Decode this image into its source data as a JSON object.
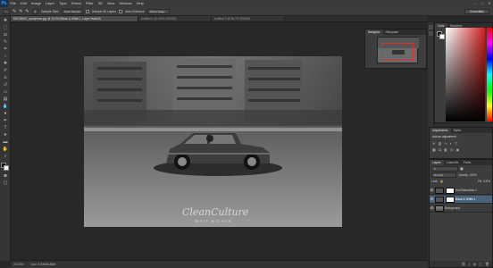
{
  "app": {
    "logo": "Ps",
    "window_controls": [
      "–",
      "□",
      "✕"
    ]
  },
  "menubar": [
    "File",
    "Edit",
    "Image",
    "Layer",
    "Type",
    "Select",
    "Filter",
    "3D",
    "View",
    "Window",
    "Help"
  ],
  "options_bar": {
    "sample_size_label": "Sample Size:",
    "sample_size_value": "Point Sample",
    "sample_all_layers": "Sample All Layers",
    "auto_enhance": "Auto-Enhance",
    "refine_edge": "Refine Edge...",
    "workspace": "Essentials"
  },
  "tabs": [
    {
      "label": "DSC06067_wordpress.jpg @ 33.3% (Black & White 1, Layer Mask/8)",
      "active": true
    },
    {
      "label": "Untitled-1 @ 100% (RGB/8)",
      "active": false
    },
    {
      "label": "Untitled-2 @ 66.7% (RGB/8)",
      "active": false
    }
  ],
  "status": {
    "zoom": "33.33%",
    "doc": "Doc: 5.93M/8.88M"
  },
  "photo": {
    "watermark_script": "CleanCulture",
    "watermark_name": "MATT WILSON"
  },
  "panels": {
    "navigator_tabs": [
      "Navigator",
      "Histogram"
    ],
    "swatch_tabs": [
      "Color",
      "Swatches"
    ],
    "adjust_tabs": [
      "Adjustments",
      "Styles"
    ],
    "adjust_title": "Add an adjustment",
    "layers_tabs": [
      "Layers",
      "Channels",
      "Paths"
    ],
    "blend_mode": "Normal",
    "opacity_label": "Opacity: 100%",
    "lock_label": "Lock:",
    "fill_label": "Fill: 100%",
    "layers": [
      {
        "name": "Hue/Saturation 1",
        "selected": false,
        "thumb": "mask"
      },
      {
        "name": "Black & White 1",
        "selected": true,
        "thumb": "mask"
      },
      {
        "name": "Background",
        "selected": false,
        "thumb": "photo"
      }
    ]
  },
  "tools": [
    "move",
    "marquee",
    "lasso",
    "quick-select",
    "crop",
    "eyedropper",
    "healing",
    "brush",
    "stamp",
    "history-brush",
    "eraser",
    "gradient",
    "blur",
    "dodge",
    "pen",
    "type",
    "path-select",
    "shape",
    "hand",
    "zoom"
  ],
  "colors": {
    "accent": "#49637f",
    "app_bg": "#282828",
    "panel_bg": "#3d3d3d"
  }
}
